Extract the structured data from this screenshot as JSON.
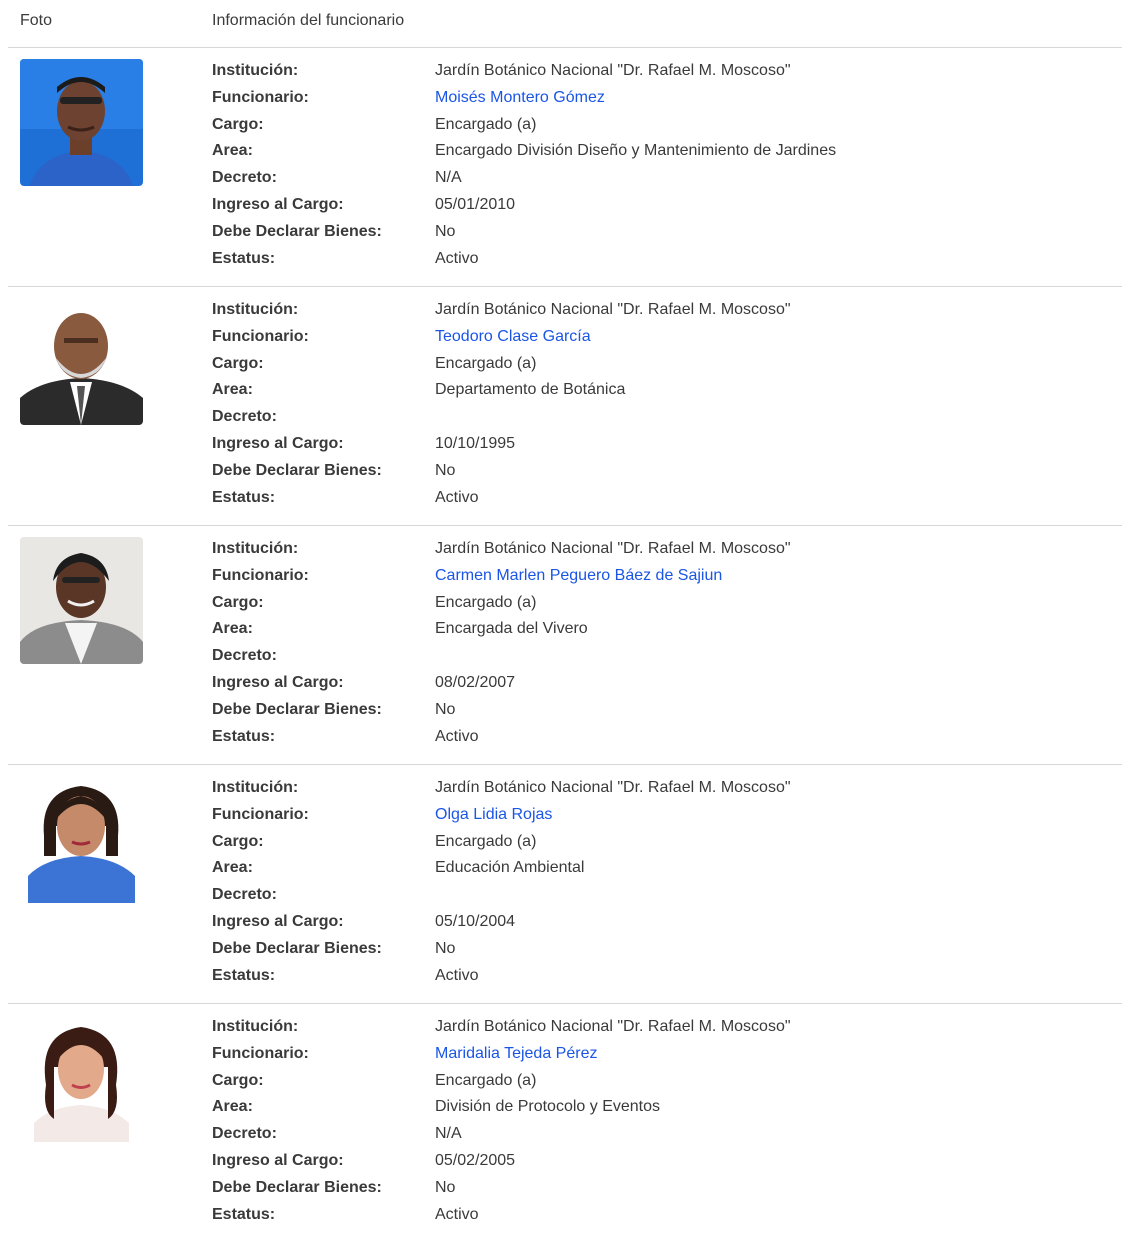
{
  "header": {
    "foto": "Foto",
    "info": "Información del funcionario"
  },
  "labels": {
    "institucion": "Institución:",
    "funcionario": "Funcionario:",
    "cargo": "Cargo:",
    "area": "Area:",
    "decreto": "Decreto:",
    "ingreso": "Ingreso al Cargo:",
    "declarar": "Debe Declarar Bienes:",
    "estatus": "Estatus:"
  },
  "colors": {
    "link": "#1a55e6",
    "divider": "#d8d8d8"
  },
  "officials": [
    {
      "institucion": "Jardín Botánico Nacional \"Dr. Rafael M. Moscoso\"",
      "funcionario": "Moisés Montero Gómez",
      "cargo": "Encargado (a)",
      "area": "Encargado División Diseño y Mantenimiento de Jardines",
      "decreto": "N/A",
      "ingreso": "05/01/2010",
      "declarar": "No",
      "estatus": "Activo"
    },
    {
      "institucion": "Jardín Botánico Nacional \"Dr. Rafael M. Moscoso\"",
      "funcionario": "Teodoro Clase García",
      "cargo": "Encargado (a)",
      "area": "Departamento de Botánica",
      "decreto": "",
      "ingreso": "10/10/1995",
      "declarar": "No",
      "estatus": "Activo"
    },
    {
      "institucion": "Jardín Botánico Nacional \"Dr. Rafael M. Moscoso\"",
      "funcionario": "Carmen Marlen Peguero Báez de Sajiun",
      "cargo": "Encargado (a)",
      "area": "Encargada del Vivero",
      "decreto": "",
      "ingreso": "08/02/2007",
      "declarar": "No",
      "estatus": "Activo"
    },
    {
      "institucion": "Jardín Botánico Nacional \"Dr. Rafael M. Moscoso\"",
      "funcionario": "Olga Lidia Rojas",
      "cargo": "Encargado (a)",
      "area": "Educación Ambiental",
      "decreto": "",
      "ingreso": "05/10/2004",
      "declarar": "No",
      "estatus": "Activo"
    },
    {
      "institucion": "Jardín Botánico Nacional \"Dr. Rafael M. Moscoso\"",
      "funcionario": "Maridalia Tejeda Pérez",
      "cargo": "Encargado (a)",
      "area": "División de Protocolo y Eventos",
      "decreto": "N/A",
      "ingreso": "05/02/2005",
      "declarar": "No",
      "estatus": "Activo"
    }
  ]
}
